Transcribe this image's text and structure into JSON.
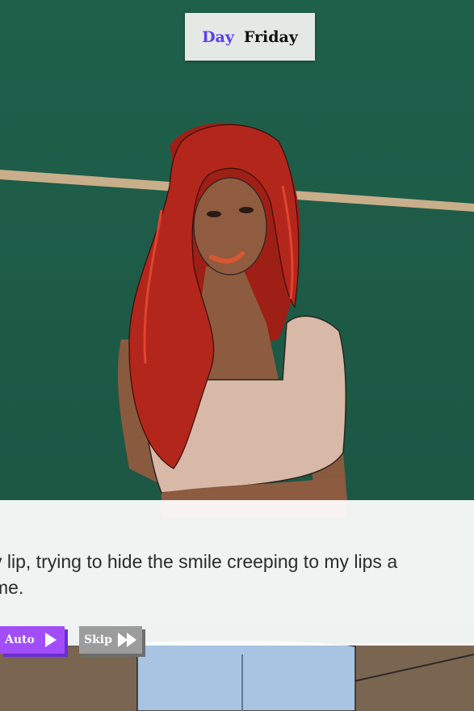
{
  "hud": {
    "day_label": "Day",
    "day_value": "Friday"
  },
  "dialogue": {
    "line1": "y lip, trying to hide the smile creeping to my lips a",
    "line2": "me."
  },
  "controls": {
    "auto_label": "Auto",
    "skip_label": "Skip",
    "auto_icon": "play-icon",
    "skip_icon": "fast-forward-icon"
  },
  "colors": {
    "wall": "#1d5a47",
    "floor": "#7a6550",
    "hair": "#b3261b",
    "top": "#d8b8a7",
    "jeans": "#a9c3e3",
    "auto_button": "#a24dfa",
    "skip_button": "#9c9c9c",
    "day_accent": "#5b3df5"
  }
}
